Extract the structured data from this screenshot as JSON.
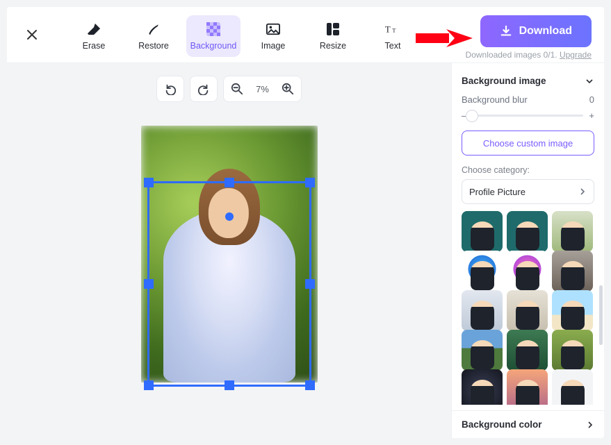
{
  "toolbar": {
    "tools": [
      {
        "id": "erase",
        "label": "Erase"
      },
      {
        "id": "restore",
        "label": "Restore"
      },
      {
        "id": "background",
        "label": "Background"
      },
      {
        "id": "image",
        "label": "Image"
      },
      {
        "id": "resize",
        "label": "Resize"
      },
      {
        "id": "text",
        "label": "Text"
      }
    ],
    "active_tool": "background",
    "download_label": "Download",
    "download_sub_prefix": "Downloaded images 0/1. ",
    "download_sub_link": "Upgrade"
  },
  "canvas": {
    "zoom_label": "7%"
  },
  "sidebar": {
    "bg_image": {
      "title": "Background image",
      "blur_label": "Background blur",
      "blur_value": "0",
      "choose_custom": "Choose custom image",
      "category_label": "Choose category:",
      "category_value": "Profile Picture"
    },
    "bg_color_title": "Background color",
    "thumbs": [
      {
        "name": "bg-teal-1",
        "style": "background:#1f6b6b"
      },
      {
        "name": "bg-teal-2",
        "style": "background:#1f6b6b"
      },
      {
        "name": "bg-flowers",
        "style": "background:linear-gradient(#d7e0c7,#9fb97b)"
      },
      {
        "name": "bg-blob-blue",
        "style": "background:radial-gradient(circle at 50% 45%, #3fb5ff 0%, #2a7dde 45%, #fff 46%)"
      },
      {
        "name": "bg-blob-magenta",
        "style": "background:radial-gradient(circle at 50% 45%, #ff6fbf 0%, #b84dd6 45%, #fff 46%)"
      },
      {
        "name": "bg-window",
        "style": "background:linear-gradient(#a7a099,#6b6159)"
      },
      {
        "name": "bg-office-1",
        "style": "background:linear-gradient(#e2e7ef,#bfcad8)"
      },
      {
        "name": "bg-office-2",
        "style": "background:linear-gradient(#e6e1d6,#c7bfae)"
      },
      {
        "name": "bg-beach",
        "style": "background:linear-gradient(#aee1ff 60%,#f2e6c6 60%)"
      },
      {
        "name": "bg-mountain",
        "style": "background:linear-gradient(#6aa3d9 45%,#4e7a3d 45%)"
      },
      {
        "name": "bg-palms",
        "style": "background:linear-gradient(#3d7a52,#1e4f34)"
      },
      {
        "name": "bg-foliage",
        "style": "background:linear-gradient(#8aac4e,#5c7b32)"
      },
      {
        "name": "bg-bokeh",
        "style": "background:radial-gradient(circle,#3a3f55,#14161f)"
      },
      {
        "name": "bg-sunset",
        "style": "background:linear-gradient(#f5a67a,#b26789)"
      },
      {
        "name": "bg-white",
        "style": "background:#f3f4f6"
      }
    ]
  }
}
